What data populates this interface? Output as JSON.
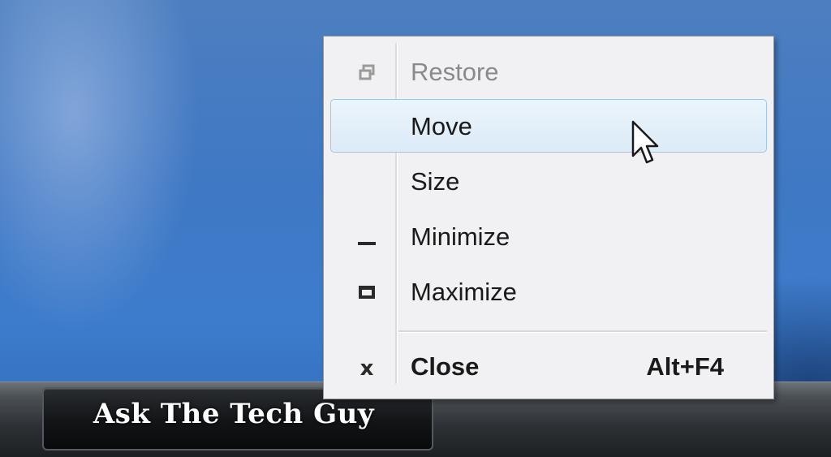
{
  "menu": {
    "items": [
      {
        "label": "Restore",
        "icon": "restore-icon",
        "state": "disabled",
        "shortcut": ""
      },
      {
        "label": "Move",
        "icon": "",
        "state": "highlighted",
        "shortcut": ""
      },
      {
        "label": "Size",
        "icon": "",
        "state": "normal",
        "shortcut": ""
      },
      {
        "label": "Minimize",
        "icon": "minimize-icon",
        "state": "normal",
        "shortcut": ""
      },
      {
        "label": "Maximize",
        "icon": "maximize-icon",
        "state": "normal",
        "shortcut": ""
      },
      {
        "label": "Close",
        "icon": "close-icon",
        "state": "default-bold",
        "shortcut": "Alt+F4"
      }
    ],
    "close_icon_glyph": "x"
  },
  "taskbar": {
    "button_label": "Ask The Tech Guy"
  },
  "colors": {
    "highlight_border": "#9fc7e8",
    "highlight_fill": "#dcebf8",
    "menu_background": "#f1f1f3",
    "disabled_text": "#8a8a8a"
  }
}
